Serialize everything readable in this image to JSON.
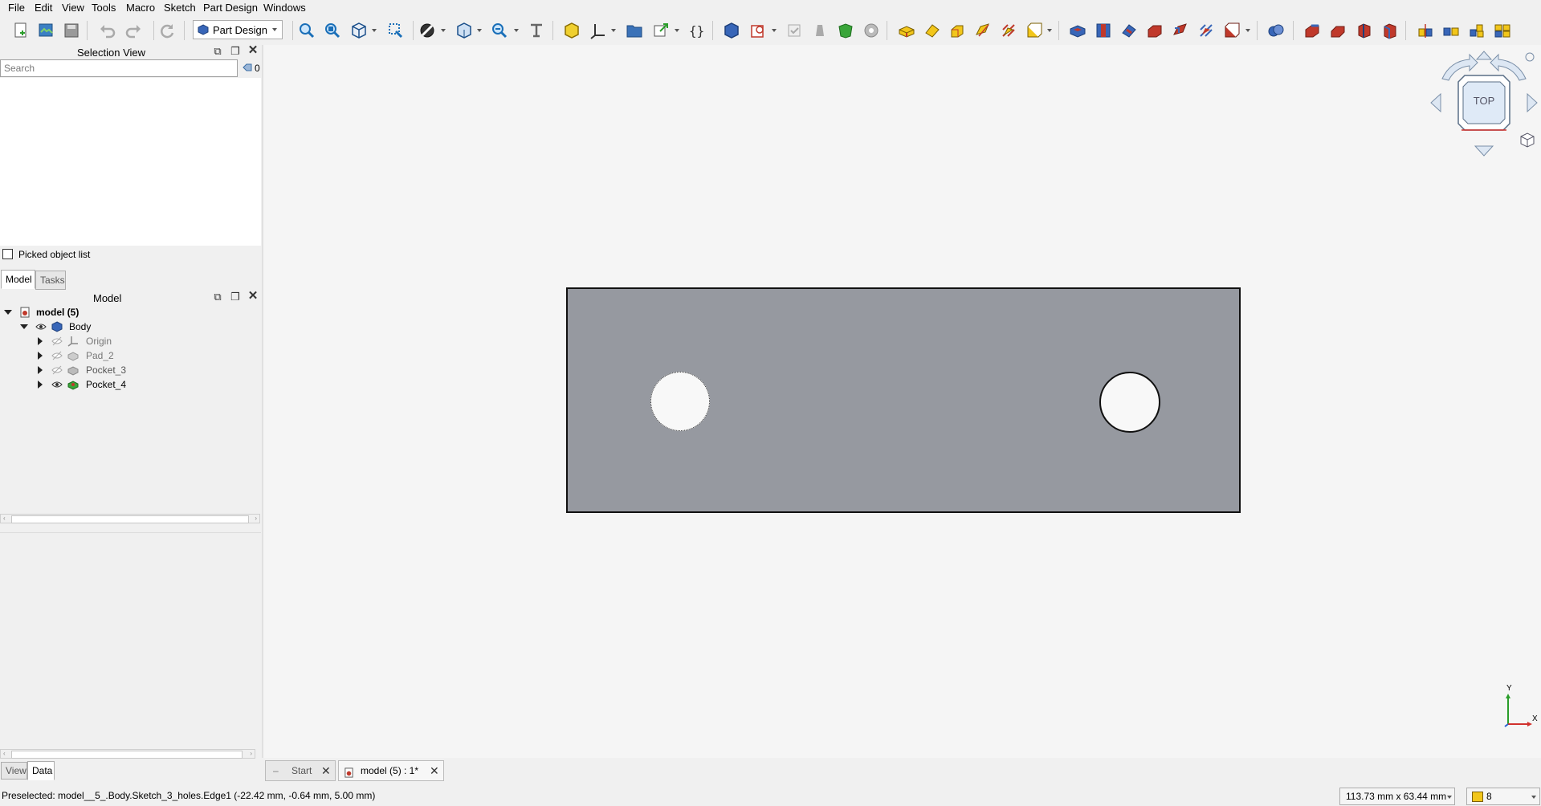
{
  "menu": [
    "File",
    "Edit",
    "View",
    "Tools",
    "Macro",
    "Sketch",
    "Part Design",
    "Windows"
  ],
  "toolbar": {
    "workbench": "Part Design",
    "icons": [
      "new-document-icon",
      "open-document-icon",
      "save-document-icon",
      "undo-icon",
      "redo-icon",
      "refresh-icon",
      "fit-all-icon",
      "fit-selection-icon",
      "isometric-view-icon",
      "box-zoom-icon",
      "draw-style-icon",
      "standard-views-icon",
      "zoom-icon",
      "measure-icon",
      "create-part-icon",
      "create-datum-icon",
      "create-group-icon",
      "link-icon",
      "macro-braces-icon",
      "create-body-icon",
      "create-sketch-icon",
      "validate-sketch-icon",
      "clone-icon",
      "shape-binder-icon",
      "subshape-binder-icon",
      "pad-icon",
      "revolution-icon",
      "additive-loft-icon",
      "additive-pipe-icon",
      "additive-primitive-icon",
      "pocket-icon",
      "hole-icon",
      "groove-icon",
      "subtractive-loft-icon",
      "subtractive-pipe-icon",
      "subtractive-primitive-icon",
      "boolean-icon",
      "fillet-icon",
      "chamfer-icon",
      "draft-icon",
      "thickness-icon",
      "mirrored-icon",
      "linear-pattern-icon",
      "polar-pattern-icon",
      "multi-transform-icon"
    ]
  },
  "selection_view": {
    "title": "Selection View",
    "search_placeholder": "Search",
    "count": "0",
    "picked_label": "Picked object list"
  },
  "tabs": {
    "model": "Model",
    "tasks": "Tasks"
  },
  "model_panel": {
    "title": "Model"
  },
  "tree": [
    {
      "label": "model (5)",
      "level": 0,
      "expanded": true,
      "icon": "document-icon",
      "bold": true
    },
    {
      "label": "Body",
      "level": 1,
      "expanded": true,
      "icon": "body-icon",
      "visible": true
    },
    {
      "label": "Origin",
      "level": 2,
      "expanded": false,
      "icon": "origin-icon",
      "visible": false
    },
    {
      "label": "Pad_2",
      "level": 2,
      "expanded": false,
      "icon": "pad-icon",
      "visible": false
    },
    {
      "label": "Pocket_3",
      "level": 2,
      "expanded": false,
      "icon": "pocket-icon",
      "visible": false
    },
    {
      "label": "Pocket_4",
      "level": 2,
      "expanded": false,
      "icon": "pocket-icon",
      "visible": true
    }
  ],
  "property_tabs": {
    "view": "View",
    "data": "Data"
  },
  "navcube": {
    "face": "TOP"
  },
  "axis": {
    "x": "X",
    "y": "Y"
  },
  "doc_tabs": {
    "start": "Start",
    "model": "model (5) : 1*"
  },
  "status": {
    "text": "Preselected: model__5_.Body.Sketch_3_holes.Edge1 (-22.42 mm, -0.64 mm, 5.00 mm)",
    "dimensions": "113.73 mm x 63.44 mm",
    "layer": "8"
  },
  "colors": {
    "plate": "#9699a0",
    "edge": "#111111",
    "background": "#f5f5f5"
  }
}
